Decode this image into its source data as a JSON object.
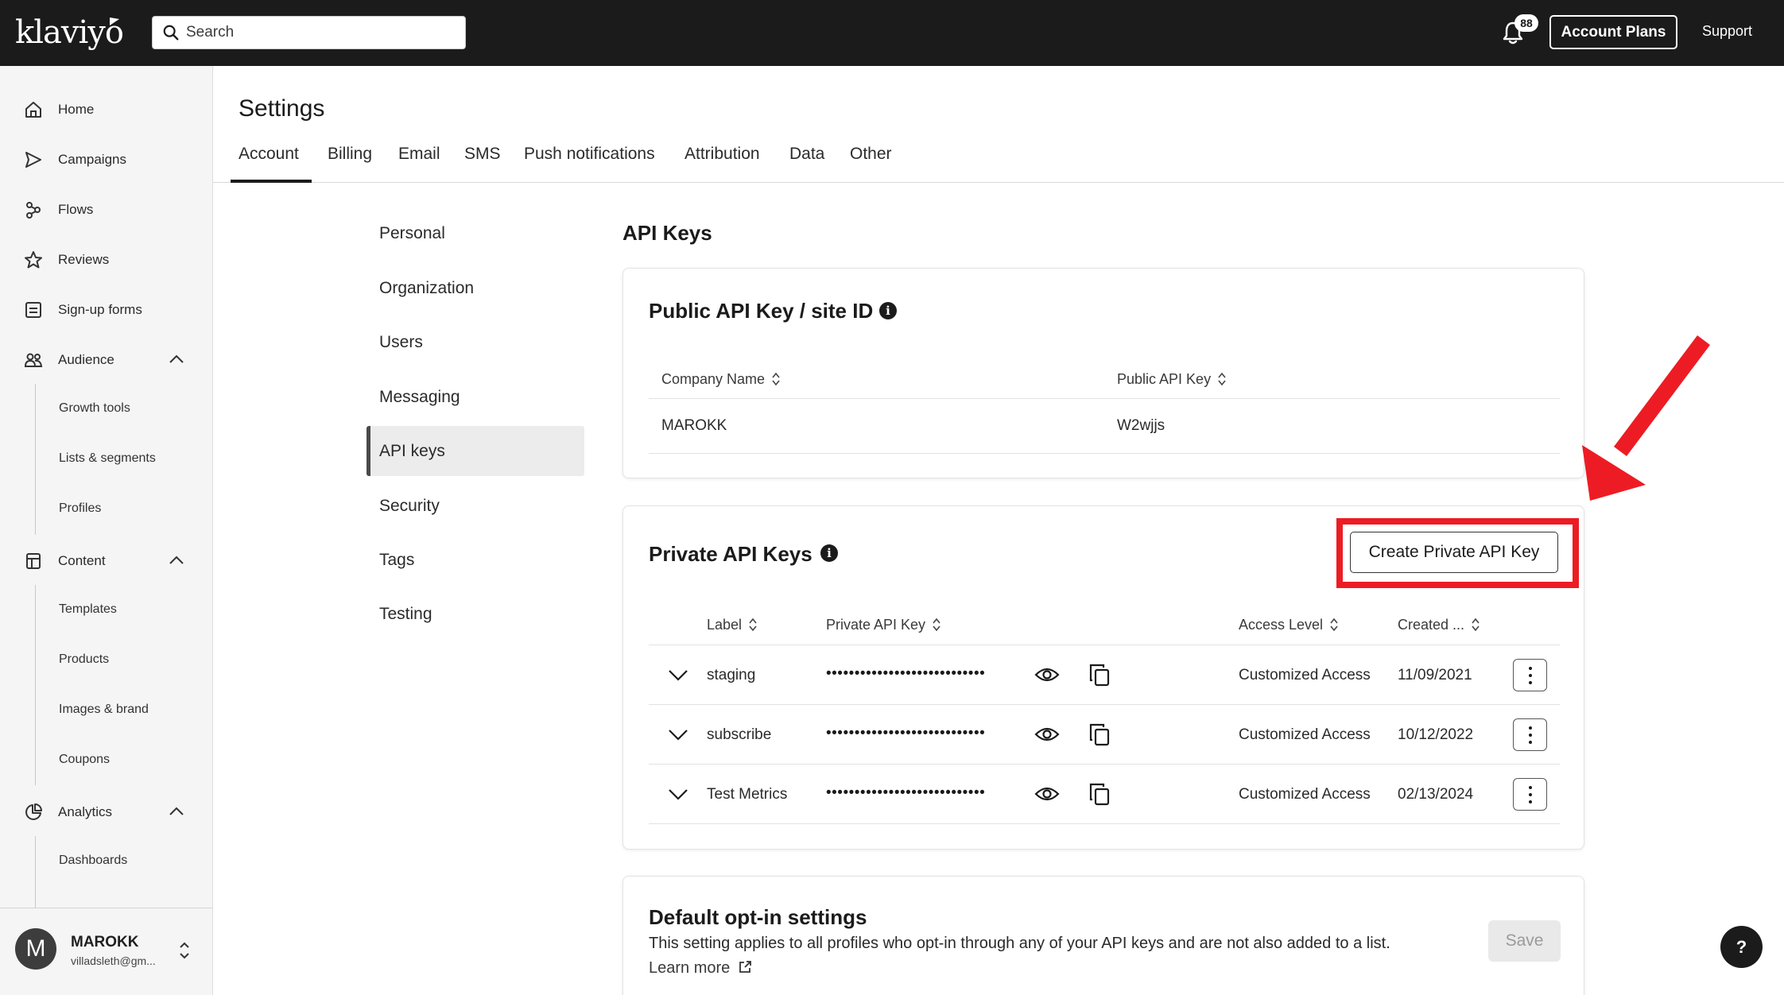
{
  "header": {
    "logo_text": "klaviyo",
    "search_placeholder": "Search",
    "notification_count": "88",
    "account_plans_label": "Account Plans",
    "support_label": "Support"
  },
  "sidebar": {
    "items": [
      {
        "label": "Home",
        "icon": "home-icon"
      },
      {
        "label": "Campaigns",
        "icon": "send-icon"
      },
      {
        "label": "Flows",
        "icon": "flows-icon"
      },
      {
        "label": "Reviews",
        "icon": "star-icon"
      },
      {
        "label": "Sign-up forms",
        "icon": "form-icon"
      },
      {
        "label": "Audience",
        "icon": "audience-icon",
        "expanded": true
      },
      {
        "label": "Content",
        "icon": "content-icon",
        "expanded": true
      },
      {
        "label": "Analytics",
        "icon": "analytics-icon",
        "expanded": true
      }
    ],
    "audience_sub": [
      "Growth tools",
      "Lists & segments",
      "Profiles"
    ],
    "content_sub": [
      "Templates",
      "Products",
      "Images & brand",
      "Coupons"
    ],
    "analytics_sub": [
      "Dashboards"
    ],
    "account": {
      "avatar_letter": "M",
      "name": "MAROKK",
      "email": "villadsleth@gm..."
    }
  },
  "page": {
    "title": "Settings",
    "tabs": [
      "Account",
      "Billing",
      "Email",
      "SMS",
      "Push notifications",
      "Attribution",
      "Data",
      "Other"
    ],
    "active_tab": "Account"
  },
  "subnav": {
    "items": [
      "Personal",
      "Organization",
      "Users",
      "Messaging",
      "API keys",
      "Security",
      "Tags",
      "Testing"
    ],
    "active": "API keys"
  },
  "content": {
    "section_title": "API Keys",
    "public_card": {
      "title": "Public API Key / site ID",
      "columns": [
        "Company Name",
        "Public API Key"
      ],
      "rows": [
        {
          "company": "MAROKK",
          "key": "W2wjjs"
        }
      ]
    },
    "private_card": {
      "title": "Private API Keys",
      "create_button": "Create Private API Key",
      "columns": [
        "Label",
        "Private API Key",
        "Access Level",
        "Created ..."
      ],
      "rows": [
        {
          "label": "staging",
          "key_mask": "••••••••••••••••••••••••••••",
          "access": "Customized Access",
          "created": "11/09/2021"
        },
        {
          "label": "subscribe",
          "key_mask": "••••••••••••••••••••••••••••",
          "access": "Customized Access",
          "created": "10/12/2022"
        },
        {
          "label": "Test Metrics",
          "key_mask": "••••••••••••••••••••••••••••",
          "access": "Customized Access",
          "created": "02/13/2024"
        }
      ]
    },
    "optin_card": {
      "title": "Default opt-in settings",
      "description": "This setting applies to all profiles who opt-in through any of your API keys and are not also added to a list.",
      "learn_more": "Learn more",
      "save_label": "Save"
    }
  },
  "help_label": "?",
  "colors": {
    "topbar": "#1b1b1b",
    "highlight": "#ed1c24",
    "sidebar_bg": "#f5f5f5"
  }
}
